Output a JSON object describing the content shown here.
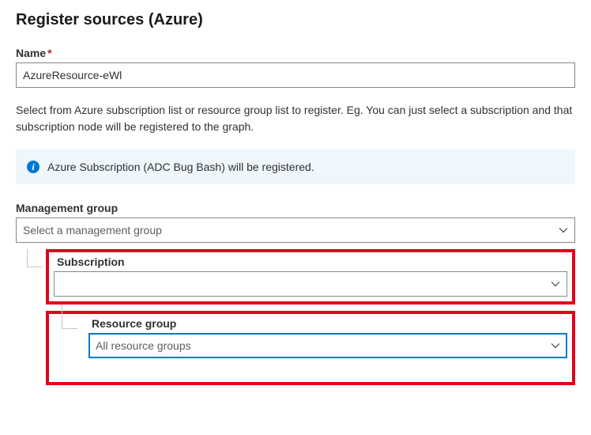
{
  "page_title": "Register sources (Azure)",
  "name_label": "Name",
  "name_value": "AzureResource-eWl",
  "description": "Select from Azure subscription list or resource group list to register. Eg. You can just select a subscription and that subscription node will be registered to the graph.",
  "info_message": "Azure Subscription (ADC Bug Bash) will be registered.",
  "management_group": {
    "label": "Management group",
    "placeholder": "Select a management group",
    "value": ""
  },
  "subscription": {
    "label": "Subscription",
    "value": ""
  },
  "resource_group": {
    "label": "Resource group",
    "value": "All resource groups"
  }
}
